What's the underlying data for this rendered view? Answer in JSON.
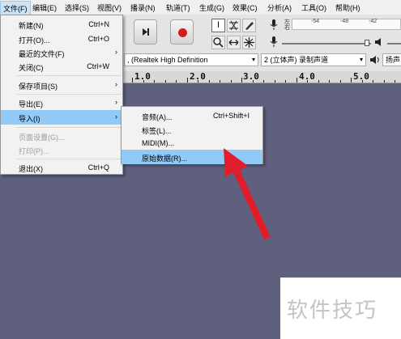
{
  "menubar": {
    "items": [
      "文件(F)",
      "编辑(E)",
      "选择(S)",
      "视图(V)",
      "播录(N)",
      "轨道(T)",
      "生成(G)",
      "效果(C)",
      "分析(A)",
      "工具(O)",
      "帮助(H)"
    ]
  },
  "file_menu": {
    "items": [
      {
        "label": "新建(N)",
        "shortcut": "Ctrl+N"
      },
      {
        "label": "打开(O)...",
        "shortcut": "Ctrl+O"
      },
      {
        "label": "最近的文件(F)",
        "shortcut": ""
      },
      {
        "label": "关闭(C)",
        "shortcut": "Ctrl+W"
      },
      {
        "label": "保存项目(S)",
        "shortcut": ""
      },
      {
        "label": "导出(E)",
        "shortcut": ""
      },
      {
        "label": "导入(I)",
        "shortcut": ""
      },
      {
        "label": "页面设置(G)...",
        "shortcut": ""
      },
      {
        "label": "打印(P)...",
        "shortcut": ""
      },
      {
        "label": "退出(X)",
        "shortcut": "Ctrl+Q"
      }
    ]
  },
  "import_submenu": {
    "items": [
      {
        "label": "音频(A)...",
        "shortcut": "Ctrl+Shift+I"
      },
      {
        "label": "标签(L)...",
        "shortcut": ""
      },
      {
        "label": "MIDI(M)...",
        "shortcut": ""
      },
      {
        "label": "原始数据(R)...",
        "shortcut": ""
      }
    ]
  },
  "meters": {
    "record_ticks": [
      "-54",
      "-48",
      "-42"
    ],
    "left_label": "左",
    "right_label": "右"
  },
  "device_bar": {
    "input_device": ", (Realtek High Definition",
    "channels": "2 (立体声) 录制声道",
    "output_device": "扬声"
  },
  "ruler": {
    "labels": [
      "1.0",
      "2.0",
      "3.0",
      "4.0",
      "5.0"
    ]
  },
  "watermark": {
    "text": "软件技巧"
  },
  "colors": {
    "track_background": "#5f5f7e",
    "menu_highlight": "#91c9f7",
    "arrow_red": "#e11d2a"
  }
}
